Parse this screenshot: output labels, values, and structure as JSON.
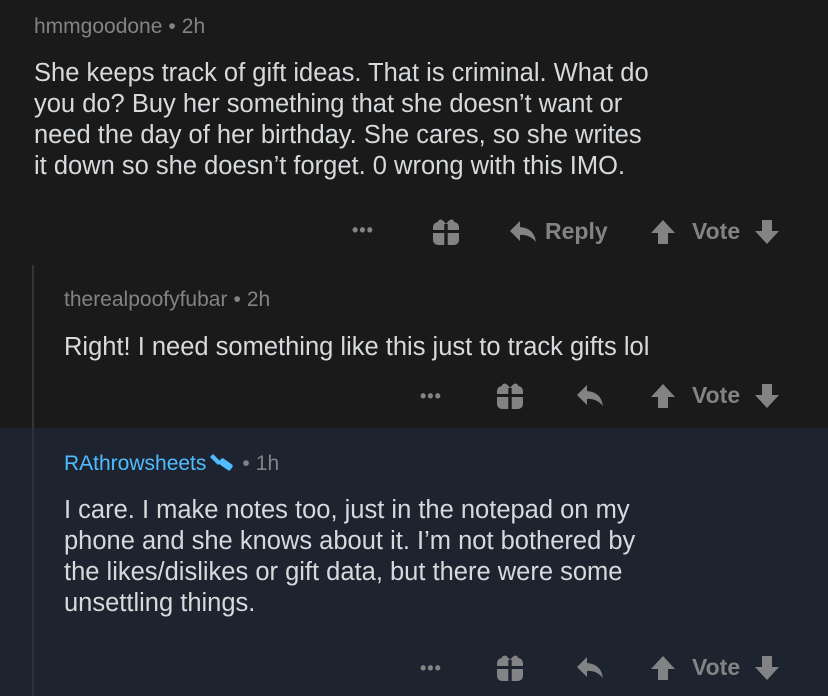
{
  "comments": [
    {
      "username": "hmmgoodone",
      "separator": "•",
      "time": "2h",
      "lines": [
        "She keeps track of gift ideas.  That is criminal.  What do",
        "you do? Buy her something that she doesn’t want or",
        "need the day of her birthday.  She cares, so she writes",
        "it down so she doesn’t forget.  0 wrong with this IMO."
      ],
      "more": "•••",
      "reply_label": "Reply",
      "vote_label": "Vote"
    },
    {
      "username": "therealpoofyfubar",
      "separator": "•",
      "time": "2h",
      "lines": [
        "Right! I need something like this just to track gifts lol"
      ],
      "more": "•••",
      "vote_label": "Vote"
    },
    {
      "username": "RAthrowsheets",
      "separator": "•",
      "time": "1h",
      "lines": [
        "I care. I make notes too, just in the notepad on my",
        "phone and she knows about it. I’m not bothered by",
        "the likes/dislikes or gift data, but there were some",
        "unsettling things."
      ],
      "more": "•••",
      "vote_label": "Vote"
    }
  ],
  "colors": {
    "background": "#1a1a1b",
    "highlight_background": "#1d2430",
    "text": "#d7dadc",
    "meta": "#818384",
    "op_username": "#4fbcff"
  },
  "icons": [
    "gift-icon",
    "reply-arrow-icon",
    "upvote-icon",
    "downvote-icon",
    "more-icon",
    "mod-shield-icon"
  ]
}
